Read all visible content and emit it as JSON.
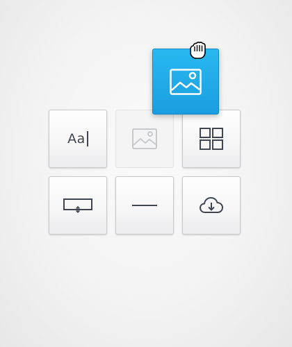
{
  "blocks": [
    {
      "name": "text-block",
      "glyph": "Aa",
      "icon": "text-caret-icon"
    },
    {
      "name": "image-block-placeholder",
      "icon": "image-icon",
      "state": "drag-source-empty"
    },
    {
      "name": "grid-block",
      "icon": "grid-icon"
    },
    {
      "name": "spacer-block",
      "icon": "spacer-resize-icon"
    },
    {
      "name": "divider-block",
      "icon": "horizontal-rule-icon"
    },
    {
      "name": "cloud-download-block",
      "icon": "cloud-download-icon"
    }
  ],
  "dragged": {
    "name": "image-block",
    "icon": "image-icon",
    "color": "#21aee9"
  },
  "cursor": {
    "icon": "grab-hand-cursor-icon"
  },
  "colors": {
    "accent": "#21aee9",
    "icon_dark": "#3f4651",
    "icon_faded": "#c7c9cd"
  }
}
